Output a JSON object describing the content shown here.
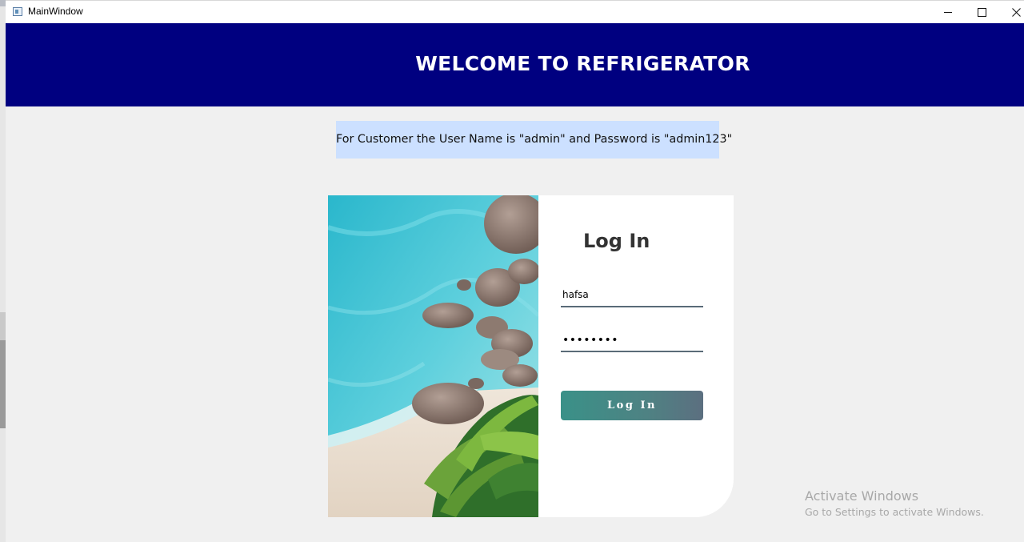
{
  "window": {
    "title": "MainWindow",
    "controls": {
      "minimize": "minimize",
      "maximize": "maximize",
      "close": "close"
    }
  },
  "header": {
    "title": "WELCOME TO REFRIGERATOR",
    "background": "#000080"
  },
  "info_banner": {
    "text": "For Customer the User Name is \"admin\" and Password is \"admin123\"",
    "background": "#cce0ff"
  },
  "login": {
    "title": "Log In",
    "username_value": "hafsa",
    "password_masked": "••••••••",
    "button_label": "Log In",
    "button_colors": [
      "#3a9188",
      "#5c6f80"
    ]
  },
  "watermark": {
    "title": "Activate Windows",
    "subtitle": "Go to Settings to activate Windows."
  },
  "image": {
    "subject": "aerial beach with turquoise water, rocks and palm trees"
  }
}
